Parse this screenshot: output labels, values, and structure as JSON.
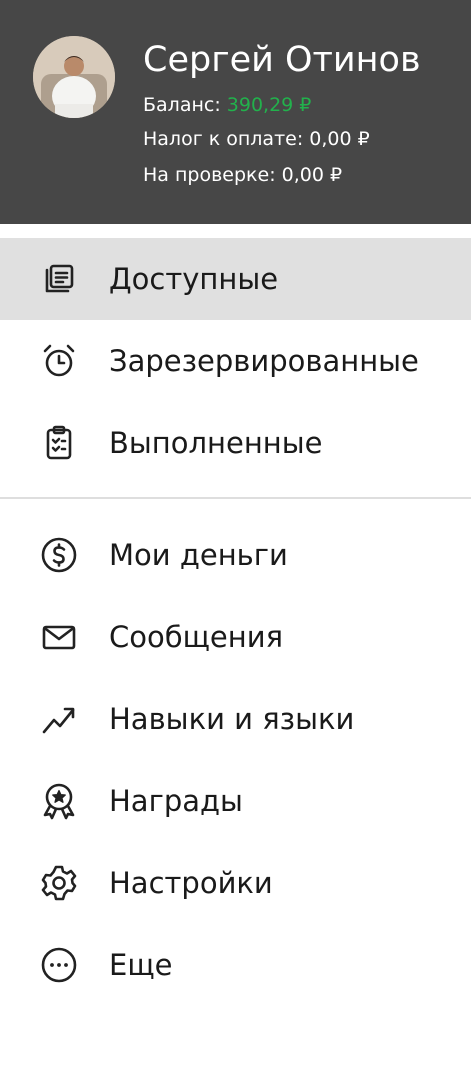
{
  "profile": {
    "name": "Сергей Отинов",
    "balance_label": "Баланс: ",
    "balance_value": "390,29 ₽",
    "balance_color": "#22b14c",
    "tax_line": "Налог к оплате: 0,00 ₽",
    "review_line": "На проверке: 0,00 ₽"
  },
  "menu": {
    "primary": [
      {
        "label": "Доступные",
        "icon": "document-list-icon",
        "active": true
      },
      {
        "label": "Зарезервированные",
        "icon": "alarm-clock-icon",
        "active": false
      },
      {
        "label": "Выполненные",
        "icon": "clipboard-check-icon",
        "active": false
      }
    ],
    "secondary": [
      {
        "label": "Мои деньги",
        "icon": "dollar-circle-icon"
      },
      {
        "label": "Сообщения",
        "icon": "envelope-icon"
      },
      {
        "label": "Навыки и языки",
        "icon": "trending-up-icon"
      },
      {
        "label": "Награды",
        "icon": "award-badge-icon"
      },
      {
        "label": "Настройки",
        "icon": "gear-icon"
      },
      {
        "label": "Еще",
        "icon": "more-dots-icon"
      }
    ]
  },
  "colors": {
    "header_bg": "#474747",
    "active_item_bg": "#e0e0e0"
  }
}
